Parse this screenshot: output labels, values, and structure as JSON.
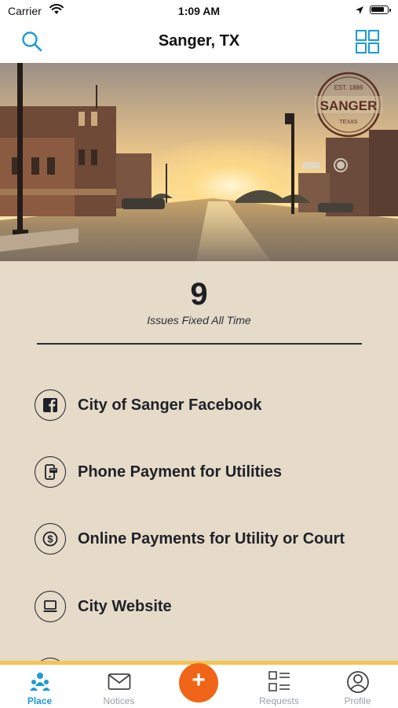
{
  "status_bar": {
    "carrier": "Carrier",
    "time": "1:09 AM",
    "battery_level": 0.85
  },
  "nav": {
    "title": "Sanger, TX",
    "search_icon": "search-icon",
    "menu_icon": "grid-icon"
  },
  "hero": {
    "seal": {
      "top_text": "EST. 1886",
      "name": "SANGER",
      "bottom_text": "TEXAS"
    }
  },
  "stats": {
    "count": "9",
    "label": "Issues Fixed All Time"
  },
  "links": [
    {
      "label": "City of Sanger Facebook",
      "icon": "facebook-icon"
    },
    {
      "label": "Phone Payment for Utilities",
      "icon": "phone-payment-icon"
    },
    {
      "label": "Online Payments for Utility or Court",
      "icon": "dollar-icon"
    },
    {
      "label": "City Website",
      "icon": "laptop-icon"
    }
  ],
  "tabs": [
    {
      "label": "Place",
      "icon": "place-icon",
      "active": true
    },
    {
      "label": "Notices",
      "icon": "envelope-icon",
      "active": false
    },
    {
      "label": "Requests",
      "icon": "requests-list-icon",
      "active": false
    },
    {
      "label": "Profile",
      "icon": "profile-icon",
      "active": false
    }
  ],
  "add_button": {
    "label": "+",
    "icon": "plus-icon"
  },
  "colors": {
    "accent_blue": "#1b9bd7",
    "add_orange": "#f06418",
    "tab_border_yellow": "#f5c452",
    "page_background": "#e6dac8",
    "text_dark": "#1e2228",
    "seal_brown": "#5b2f22"
  }
}
